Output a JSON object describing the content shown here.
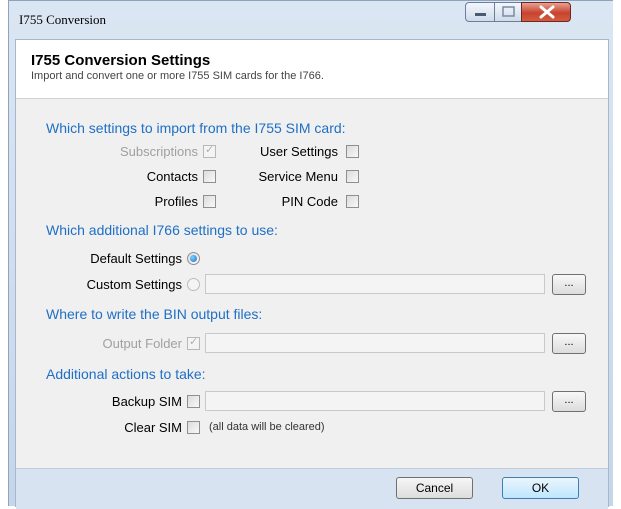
{
  "window": {
    "title": "I755 Conversion"
  },
  "header": {
    "title": "I755 Conversion Settings",
    "subtitle": "Import and convert one or more I755 SIM cards for the I766."
  },
  "import_section": {
    "heading": "Which settings to import from the I755 SIM card:",
    "subscriptions": {
      "label": "Subscriptions",
      "checked": true,
      "enabled": false
    },
    "user_settings": {
      "label": "User Settings",
      "checked": false
    },
    "contacts": {
      "label": "Contacts",
      "checked": false
    },
    "service_menu": {
      "label": "Service Menu",
      "checked": false
    },
    "profiles": {
      "label": "Profiles",
      "checked": false
    },
    "pin_code": {
      "label": "PIN Code",
      "checked": false
    }
  },
  "additional_section": {
    "heading": "Which additional I766 settings to use:",
    "default_settings": {
      "label": "Default Settings",
      "selected": true
    },
    "custom_settings": {
      "label": "Custom Settings",
      "selected": false,
      "path": "",
      "browse": "..."
    }
  },
  "output_section": {
    "heading": "Where to write the BIN output files:",
    "output_folder": {
      "label": "Output Folder",
      "checked": true,
      "enabled": false,
      "path": "",
      "browse": "..."
    }
  },
  "actions_section": {
    "heading": "Additional actions to take:",
    "backup_sim": {
      "label": "Backup SIM",
      "checked": false,
      "path": "",
      "browse": "..."
    },
    "clear_sim": {
      "label": "Clear SIM",
      "checked": false,
      "note": "(all data will be cleared)"
    }
  },
  "footer": {
    "cancel": "Cancel",
    "ok": "OK"
  },
  "colors": {
    "section_heading": "#1f6fc5",
    "footer_bg": "#d7e3f1",
    "titlebar": "#dbe6f3"
  }
}
